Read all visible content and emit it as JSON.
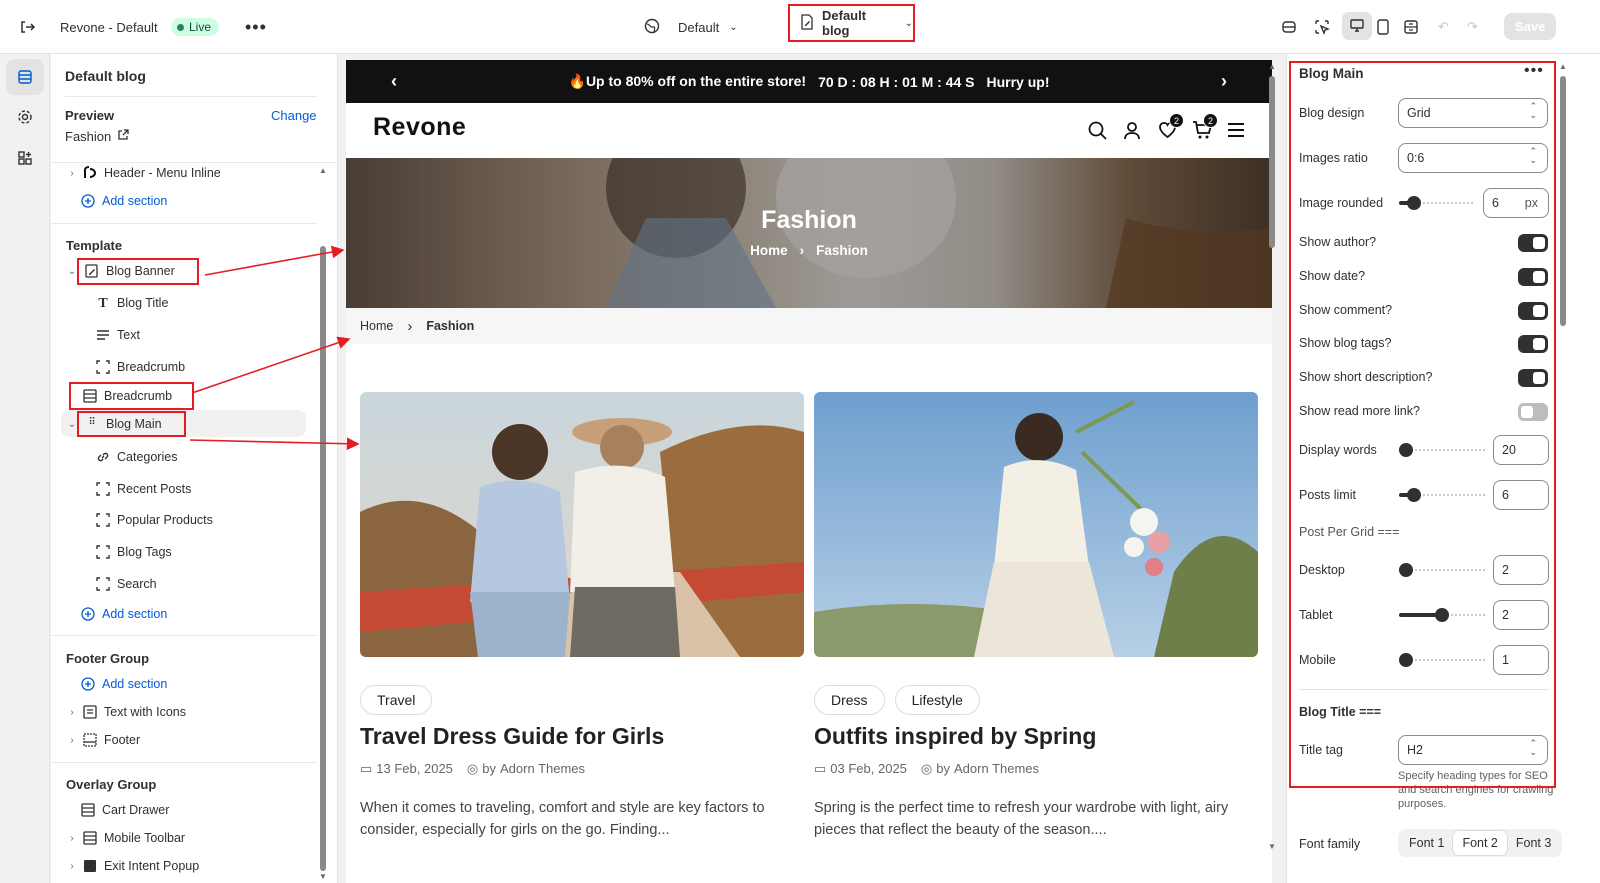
{
  "topbar": {
    "store": "Revone - Default",
    "status": "Live",
    "theme": "Default",
    "template": "Default blog",
    "save": "Save"
  },
  "left": {
    "title": "Default blog",
    "preview_label": "Preview",
    "change": "Change",
    "preview_value": "Fashion",
    "header_item": "Header - Menu Inline",
    "add_section": "Add section",
    "template_label": "Template",
    "blog_banner": "Blog Banner",
    "blog_title": "Blog Title",
    "text": "Text",
    "breadcrumb_sub": "Breadcrumb",
    "breadcrumb": "Breadcrumb",
    "blog_main": "Blog Main",
    "categories": "Categories",
    "recent_posts": "Recent Posts",
    "popular_products": "Popular Products",
    "blog_tags": "Blog Tags",
    "search": "Search",
    "footer_group": "Footer Group",
    "text_with_icons": "Text with Icons",
    "footer": "Footer",
    "overlay_group": "Overlay Group",
    "cart_drawer": "Cart Drawer",
    "mobile_toolbar": "Mobile Toolbar",
    "exit_intent": "Exit Intent Popup"
  },
  "site": {
    "announcement": "🔥Up to 80% off on the entire store!",
    "countdown": "70 D : 08 H : 01 M : 44 S",
    "hurry": "Hurry up!",
    "logo": "Revone",
    "wish_count": "2",
    "cart_count": "2",
    "hero_title": "Fashion",
    "hero_home": "Home",
    "hero_current": "Fashion",
    "crumb_home": "Home",
    "crumb_current": "Fashion",
    "posts": [
      {
        "tags": [
          "Travel"
        ],
        "title": "Travel Dress Guide for Girls",
        "date": "13 Feb, 2025",
        "by": "by",
        "author": "Adorn Themes",
        "desc": "When it comes to traveling, comfort and style are key factors to consider, especially for girls on the go. Finding..."
      },
      {
        "tags": [
          "Dress",
          "Lifestyle"
        ],
        "title": "Outfits inspired by Spring",
        "date": "03 Feb, 2025",
        "by": "by",
        "author": "Adorn Themes",
        "desc": "Spring is the perfect time to refresh your wardrobe with light, airy pieces that reflect the beauty of the season...."
      }
    ]
  },
  "right": {
    "title": "Blog Main",
    "blog_design_label": "Blog design",
    "blog_design": "Grid",
    "images_ratio_label": "Images ratio",
    "images_ratio": "0:6",
    "image_rounded_label": "Image rounded",
    "image_rounded": "6",
    "unit": "px",
    "show_author": "Show author?",
    "show_date": "Show date?",
    "show_comment": "Show comment?",
    "show_tags": "Show blog tags?",
    "show_short": "Show short description?",
    "show_read_more": "Show read more link?",
    "toggles": {
      "author": true,
      "date": true,
      "comment": true,
      "tags": true,
      "short": true,
      "read_more": false
    },
    "display_words_label": "Display words",
    "display_words": "20",
    "posts_limit_label": "Posts limit",
    "posts_limit": "6",
    "ppg_label": "Post Per Grid ===",
    "desktop_label": "Desktop",
    "desktop": "2",
    "tablet_label": "Tablet",
    "tablet": "2",
    "mobile_label": "Mobile",
    "mobile": "1",
    "blog_title_head": "Blog Title ===",
    "title_tag_label": "Title tag",
    "title_tag": "H2",
    "title_tag_help": "Specify heading types for SEO and search engines for crawling purposes.",
    "font_family_label": "Font family",
    "fonts": [
      "Font 1",
      "Font 2",
      "Font 3"
    ],
    "font_selected": "Font 2"
  },
  "colors": {
    "accent": "#005bd3",
    "annotation": "#e51c23",
    "dark": "#303030"
  }
}
